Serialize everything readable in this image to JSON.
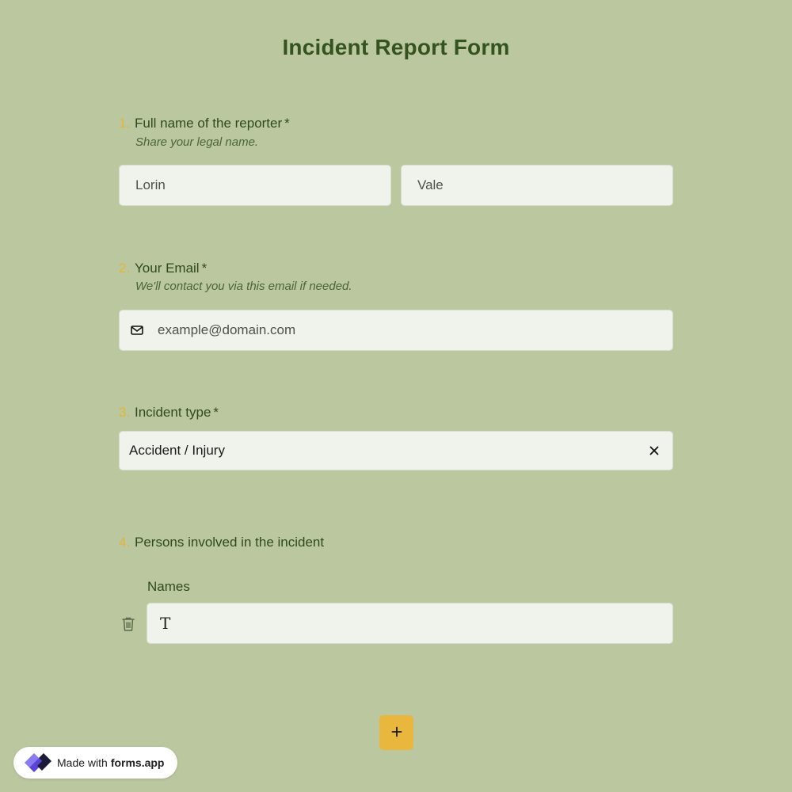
{
  "form": {
    "title": "Incident Report Form"
  },
  "questions": [
    {
      "number": "1.",
      "label": "Full name of the reporter",
      "required_mark": "*",
      "description": "Share your legal name.",
      "first_name_value": "Lorin",
      "last_name_value": "Vale"
    },
    {
      "number": "2.",
      "label": "Your Email",
      "required_mark": "*",
      "description": "We'll contact you via this email if needed.",
      "email_placeholder": "example@domain.com",
      "icon": "envelope-icon"
    },
    {
      "number": "3.",
      "label": "Incident type",
      "required_mark": "*",
      "selected_value": "Accident / Injury",
      "clear_icon": "close-icon"
    },
    {
      "number": "4.",
      "label": "Persons involved in the incident",
      "sub_label": "Names",
      "row_icon": "text-type-icon",
      "delete_icon": "trash-icon",
      "add_icon": "plus-icon"
    }
  ],
  "badge": {
    "prefix": "Made with",
    "brand": "forms.app"
  },
  "colors": {
    "background": "#bac79f",
    "accent": "#e9b63e",
    "title": "#355320",
    "question_number": "#e3b53c"
  }
}
